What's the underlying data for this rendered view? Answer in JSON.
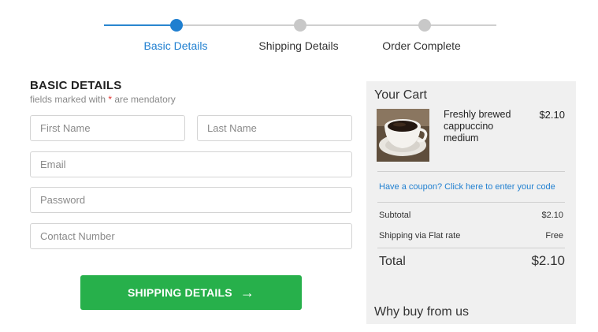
{
  "stepper": {
    "steps": [
      {
        "label": "Basic Details",
        "state": "active"
      },
      {
        "label": "Shipping Details",
        "state": "pending"
      },
      {
        "label": "Order Complete",
        "state": "pending"
      }
    ],
    "active_color": "#1f7fd0",
    "pending_color": "#c8c8c8"
  },
  "form": {
    "title": "BASIC DETAILS",
    "subtitle_before": "fields marked with ",
    "required_mark": "*",
    "subtitle_after": " are mendatory",
    "fields": {
      "first_name": {
        "placeholder": "First Name",
        "value": ""
      },
      "last_name": {
        "placeholder": "Last Name",
        "value": ""
      },
      "email": {
        "placeholder": "Email",
        "value": ""
      },
      "password": {
        "placeholder": "Password",
        "value": ""
      },
      "contact": {
        "placeholder": "Contact Number",
        "value": ""
      }
    },
    "submit": {
      "label": "SHIPPING DETAILS",
      "icon": "arrow-right-icon",
      "color": "#27b04b"
    }
  },
  "cart": {
    "title": "Your Cart",
    "item": {
      "name": "Freshly brewed cappuccino medium",
      "price": "$2.10",
      "image": "coffee-cup-image"
    },
    "coupon_link": "Have a coupon? Click here to enter your code",
    "subtotal": {
      "label": "Subtotal",
      "value": "$2.10"
    },
    "shipping": {
      "label": "Shipping via Flat rate",
      "value": "Free"
    },
    "total": {
      "label": "Total",
      "value": "$2.10"
    },
    "why_title": "Why buy from us"
  }
}
